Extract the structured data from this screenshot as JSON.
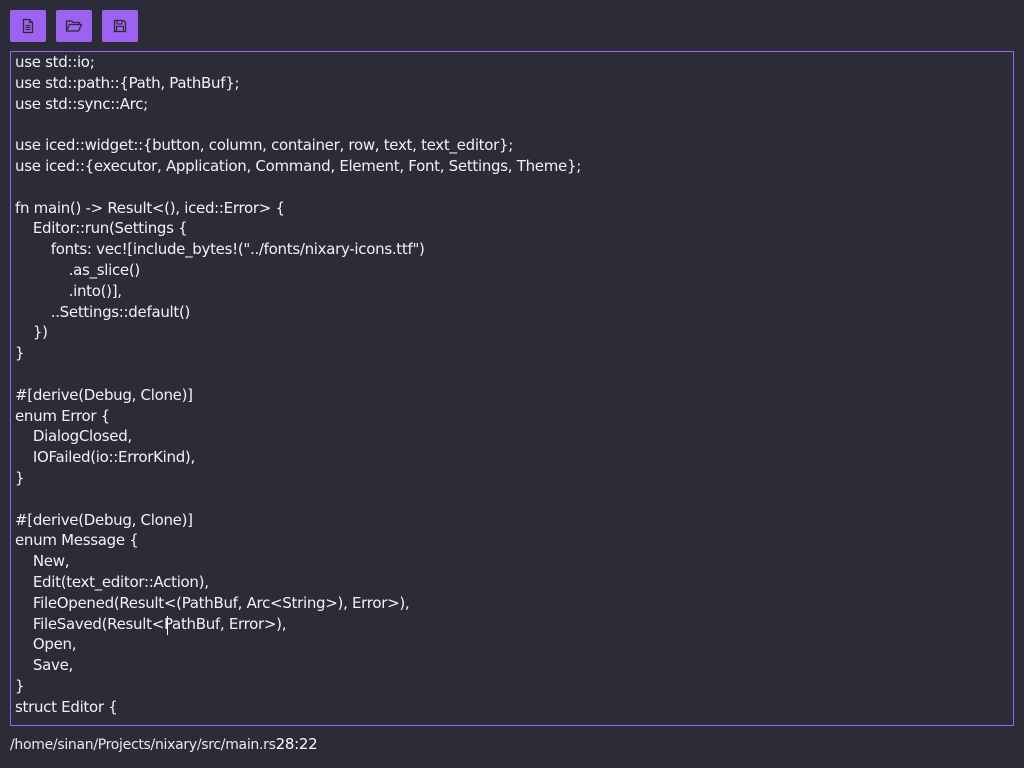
{
  "toolbar": {
    "buttons": [
      {
        "name": "new-file",
        "icon": "new-file-icon"
      },
      {
        "name": "open-file",
        "icon": "open-folder-icon"
      },
      {
        "name": "save-file",
        "icon": "save-icon"
      }
    ],
    "accent_color": "#9d62f0"
  },
  "editor": {
    "border_color": "#9d62f0",
    "background": "#2b2c37",
    "lines": [
      "use std::io;",
      "use std::path::{Path, PathBuf};",
      "use std::sync::Arc;",
      "",
      "use iced::widget::{button, column, container, row, text, text_editor};",
      "use iced::{executor, Application, Command, Element, Font, Settings, Theme};",
      "",
      "fn main() -> Result<(), iced::Error> {",
      "    Editor::run(Settings {",
      "        fonts: vec![include_bytes!(\"../fonts/nixary-icons.ttf\")",
      "            .as_slice()",
      "            .into()],",
      "        ..Settings::default()",
      "    })",
      "}",
      "",
      "#[derive(Debug, Clone)]",
      "enum Error {",
      "    DialogClosed,",
      "    IOFailed(io::ErrorKind),",
      "}",
      "",
      "#[derive(Debug, Clone)]",
      "enum Message {",
      "    New,",
      "    Edit(text_editor::Action),",
      "    FileOpened(Result<(PathBuf, Arc<String>), Error>),",
      "    FileSaved(Result<PathBuf, Error>),",
      "    Open,",
      "    Save,",
      "}",
      "struct Editor {"
    ]
  },
  "status": {
    "path": "/home/sinan/Projects/nixary/src/main.rs",
    "position": "28:22"
  }
}
